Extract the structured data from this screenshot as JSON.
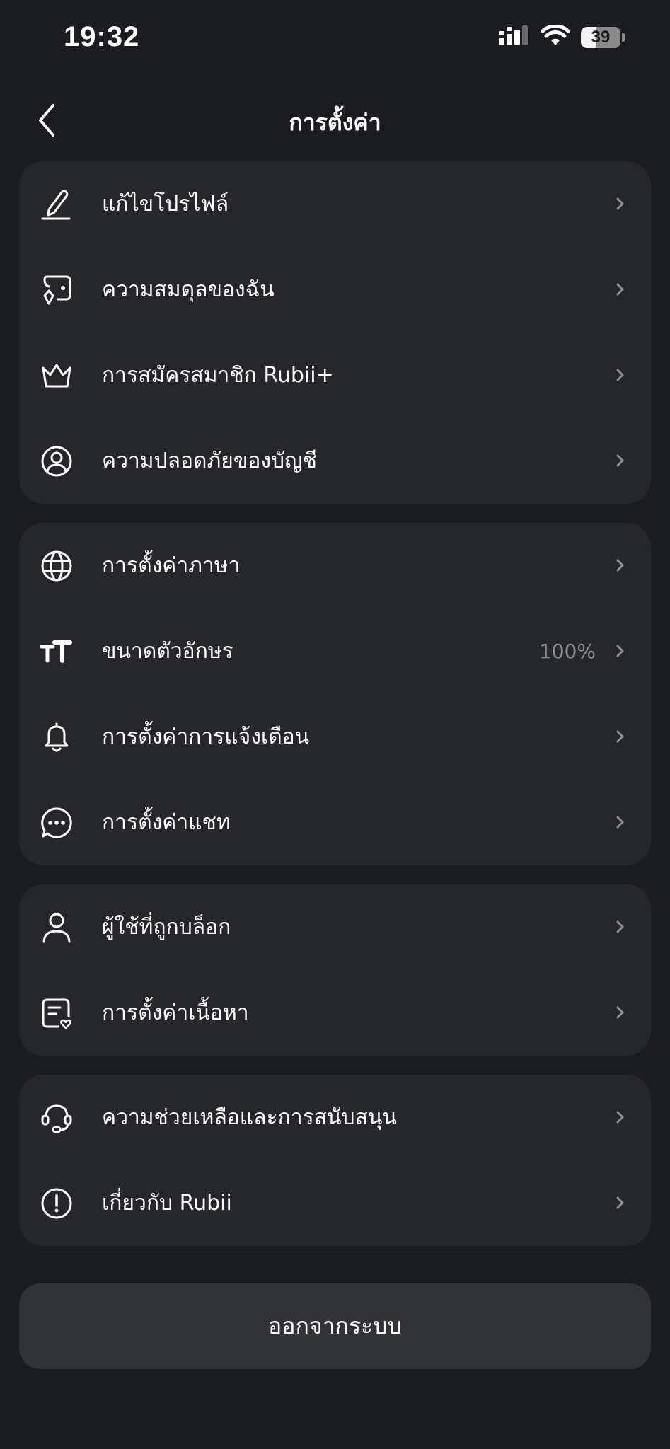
{
  "status_bar": {
    "time": "19:32",
    "battery_level": "39",
    "battery_fraction": 0.39,
    "icons": [
      "signal-icon",
      "wifi-icon",
      "battery-icon"
    ]
  },
  "header": {
    "title": "การตั้งค่า",
    "back_icon": "chevron-left-icon"
  },
  "groups": [
    {
      "items": [
        {
          "id": "edit-profile",
          "label": "แก้ไขโปรไฟล์",
          "icon": "edit-pencil-icon"
        },
        {
          "id": "my-balance",
          "label": "ความสมดุลของฉัน",
          "icon": "wallet-diamond-icon"
        },
        {
          "id": "rubii-plus-subscription",
          "label": "การสมัครสมาชิก Rubii+",
          "icon": "crown-icon"
        },
        {
          "id": "account-security",
          "label": "ความปลอดภัยของบัญชี",
          "icon": "user-circle-icon"
        }
      ]
    },
    {
      "items": [
        {
          "id": "language-settings",
          "label": "การตั้งค่าภาษา",
          "icon": "globe-icon"
        },
        {
          "id": "font-size",
          "label": "ขนาดตัวอักษร",
          "value": "100%",
          "icon": "text-size-icon"
        },
        {
          "id": "notification-settings",
          "label": "การตั้งค่าการแจ้งเตือน",
          "icon": "bell-icon"
        },
        {
          "id": "chat-settings",
          "label": "การตั้งค่าแชท",
          "icon": "chat-bubble-icon"
        }
      ]
    },
    {
      "items": [
        {
          "id": "blocked-users",
          "label": "ผู้ใช้ที่ถูกบล็อก",
          "icon": "user-icon"
        },
        {
          "id": "content-settings",
          "label": "การตั้งค่าเนื้อหา",
          "icon": "document-heart-icon"
        }
      ]
    },
    {
      "items": [
        {
          "id": "help-support",
          "label": "ความช่วยเหลือและการสนับสนุน",
          "icon": "headset-icon"
        },
        {
          "id": "about-rubii",
          "label": "เกี่ยวกับ Rubii",
          "icon": "info-exclamation-icon"
        }
      ]
    }
  ],
  "logout": {
    "label": "ออกจากระบบ"
  },
  "colors": {
    "background": "#1b1c1f",
    "card": "#26272b",
    "button": "#323336",
    "text": "#ffffff",
    "secondary_text": "#8e8f95",
    "chevron": "#8e8f95"
  }
}
